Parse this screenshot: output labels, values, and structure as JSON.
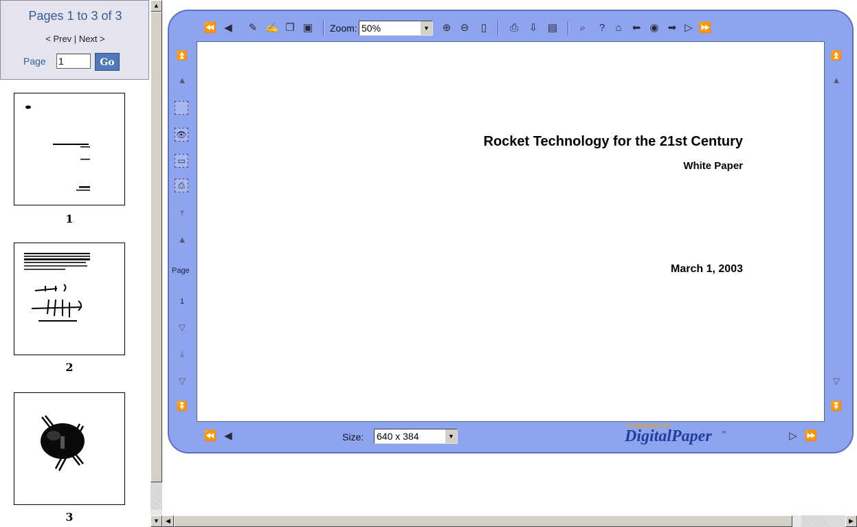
{
  "nav": {
    "pages_title": "Pages 1 to 3 of 3",
    "prev": "< Prev",
    "separator": "|",
    "next": "Next >",
    "page_label": "Page",
    "page_value": "1",
    "go_label": "Go"
  },
  "thumbnails": [
    {
      "number": "1"
    },
    {
      "number": "2"
    },
    {
      "number": "3"
    }
  ],
  "toolbar": {
    "zoom_label": "Zoom:",
    "zoom_value": "50%",
    "size_label": "Size:",
    "size_value": "640 x 384",
    "icons": {
      "first_page": "double-left-triangle",
      "prev_page": "left-triangle",
      "edit": "pencil-note",
      "annotate": "highlighter",
      "copy": "copy-pages",
      "export": "image-export",
      "zoom_in": "magnifier-plus",
      "zoom_out": "magnifier-minus",
      "fit_page": "page",
      "print": "printer",
      "download": "download-tray",
      "properties": "document-properties",
      "search": "magnifier-glass",
      "help": "question-mark",
      "home": "house",
      "back": "arrow-left",
      "contents": "globe",
      "forward": "arrow-right",
      "next_page": "right-triangle",
      "last_page": "double-right-triangle"
    }
  },
  "side": {
    "page_label": "Page",
    "page_number": "1"
  },
  "document": {
    "title": "Rocket Technology for the 21st Century",
    "subtitle": "White Paper",
    "date": "March 1, 2003"
  },
  "brand": {
    "powered_by": "POWERED BY",
    "name": "DigitalPaper",
    "tm": "™"
  },
  "colors": {
    "viewer_frame": "#8fa4ee",
    "go_button": "#4f79b8",
    "nav_title": "#3a5a9a",
    "brand": "#1f3f9a",
    "brand_powered": "#e8a020"
  }
}
